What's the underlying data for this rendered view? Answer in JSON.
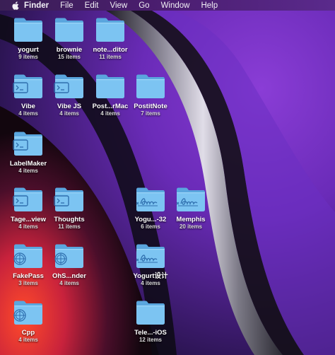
{
  "menubar": {
    "apple_icon": "apple-icon",
    "app_name": "Finder",
    "menus": [
      "File",
      "Edit",
      "View",
      "Go",
      "Window",
      "Help"
    ]
  },
  "desktop": {
    "items": [
      {
        "name": "yogurt",
        "count": "9 items",
        "emblem": "none"
      },
      {
        "name": "brownie",
        "count": "15 items",
        "emblem": "none"
      },
      {
        "name": "note...ditor",
        "count": "11 items",
        "emblem": "none"
      },
      {
        "name": "Vibe",
        "count": "4 items",
        "emblem": "terminal"
      },
      {
        "name": "Vibe JS",
        "count": "4 items",
        "emblem": "terminal"
      },
      {
        "name": "Post...rMac",
        "count": "4 items",
        "emblem": "none"
      },
      {
        "name": "PostitNote",
        "count": "7 items",
        "emblem": "none"
      },
      {
        "name": "LabelMaker",
        "count": "4 items",
        "emblem": "terminal"
      },
      {
        "name": "Tage...view",
        "count": "4 items",
        "emblem": "terminal"
      },
      {
        "name": "Thoughts",
        "count": "11 items",
        "emblem": "terminal"
      },
      {
        "name": "Yogu...-32",
        "count": "6 items",
        "emblem": "signature"
      },
      {
        "name": "Memphis",
        "count": "20 items",
        "emblem": "signature"
      },
      {
        "name": "FakePass",
        "count": "3 items",
        "emblem": "app"
      },
      {
        "name": "OhS...nder",
        "count": "4 items",
        "emblem": "app"
      },
      {
        "name": "Yogurt设计",
        "count": "4 items",
        "emblem": "signature"
      },
      {
        "name": "Cpp",
        "count": "4 items",
        "emblem": "app"
      },
      {
        "name": "Tele...-iOS",
        "count": "12 items",
        "emblem": "none"
      }
    ]
  },
  "colors": {
    "folder_front": "#7cc4f2",
    "folder_back": "#5aa6de",
    "emblem": "#2f6fae"
  }
}
